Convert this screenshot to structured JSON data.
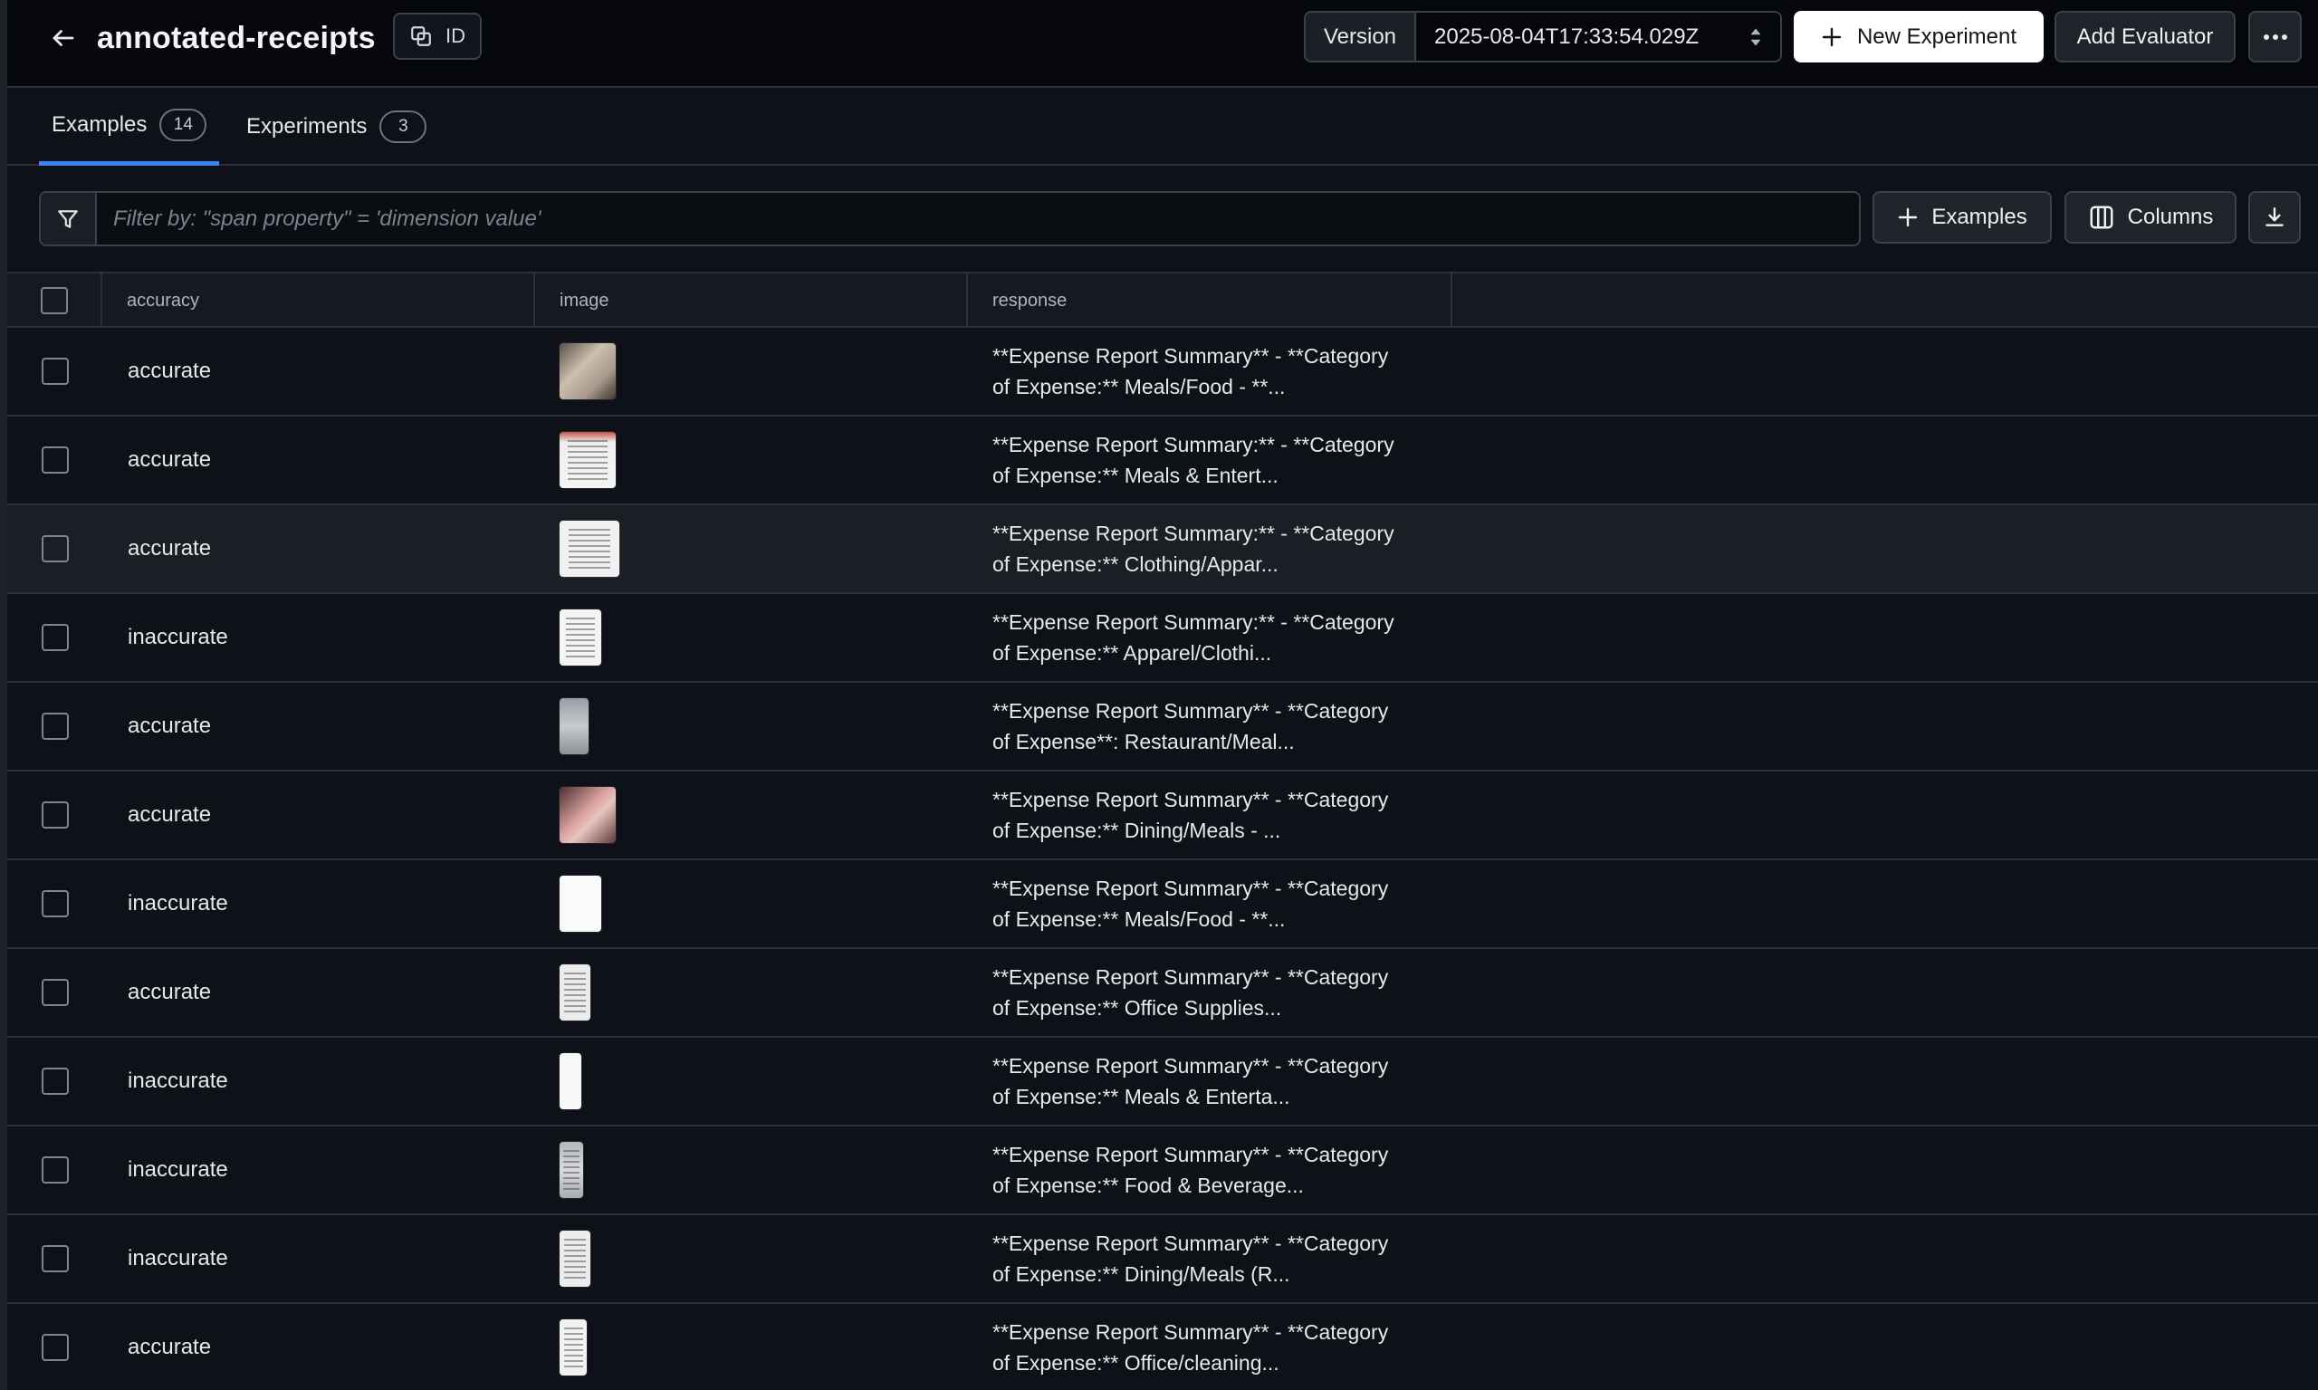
{
  "header": {
    "title": "annotated-receipts",
    "id_button_label": "ID",
    "version_label": "Version",
    "version_value": "2025-08-04T17:33:54.029Z",
    "new_experiment_label": "New Experiment",
    "add_evaluator_label": "Add Evaluator"
  },
  "tabs": [
    {
      "label": "Examples",
      "count": "14",
      "active": true
    },
    {
      "label": "Experiments",
      "count": "3",
      "active": false
    }
  ],
  "filter": {
    "placeholder": "Filter by: \"span property\" = 'dimension value'",
    "examples_button_label": "Examples",
    "columns_button_label": "Columns"
  },
  "table": {
    "columns": [
      "accuracy",
      "image",
      "response"
    ],
    "rows": [
      {
        "accuracy": "accurate",
        "thumb": "photo-tan",
        "response": "**Expense Report Summary** - **Category\nof Expense:** Meals/Food - **..."
      },
      {
        "accuracy": "accurate",
        "thumb": "paper-red",
        "response": "**Expense Report Summary:** - **Category\nof Expense:** Meals & Entert..."
      },
      {
        "accuracy": "accurate",
        "thumb": "paper-grid",
        "response": "**Expense Report Summary:** - **Category\nof Expense:** Clothing/Appar..."
      },
      {
        "accuracy": "inaccurate",
        "thumb": "paper-tall",
        "response": "**Expense Report Summary:** - **Category\nof Expense:** Apparel/Clothi..."
      },
      {
        "accuracy": "accurate",
        "thumb": "gray-narrow",
        "response": "**Expense Report Summary** - **Category\nof Expense**: Restaurant/Meal..."
      },
      {
        "accuracy": "accurate",
        "thumb": "photo-pink",
        "response": "**Expense Report Summary** - **Category\nof Expense:** Dining/Meals - ..."
      },
      {
        "accuracy": "inaccurate",
        "thumb": "white-blank",
        "response": "**Expense Report Summary** - **Category\nof Expense:** Meals/Food - **..."
      },
      {
        "accuracy": "accurate",
        "thumb": "paper-narrow",
        "response": "**Expense Report Summary** - **Category\nof Expense:** Office Supplies..."
      },
      {
        "accuracy": "inaccurate",
        "thumb": "white-slim",
        "response": "**Expense Report Summary** - **Category\nof Expense:** Meals & Enterta..."
      },
      {
        "accuracy": "inaccurate",
        "thumb": "gray-slim",
        "response": "**Expense Report Summary** - **Category\nof Expense:** Food & Beverage..."
      },
      {
        "accuracy": "inaccurate",
        "thumb": "paper-narrow",
        "response": "**Expense Report Summary** - **Category\nof Expense:** Dining/Meals (R..."
      },
      {
        "accuracy": "accurate",
        "thumb": "paper-slim",
        "response": "**Expense Report Summary** - **Category\nof Expense:** Office/cleaning..."
      }
    ]
  },
  "icons": {
    "back": "arrow-left-icon",
    "id": "copy-icon",
    "version_select": "chevron-up-down-icon",
    "new_experiment": "plus-icon",
    "more": "more-horizontal-icon",
    "filter": "filter-icon",
    "examples": "plus-icon",
    "columns": "columns-icon",
    "download": "download-icon"
  },
  "colors": {
    "accent": "#3b82f6",
    "background": "#0e1117",
    "header_bg": "#05070a"
  }
}
